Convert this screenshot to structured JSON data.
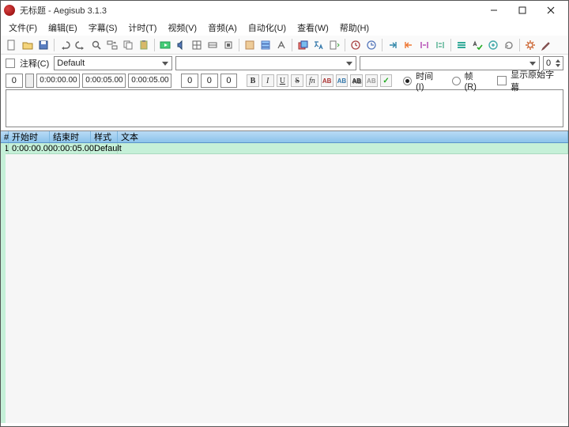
{
  "window": {
    "title": "无标题 - Aegisub 3.1.3"
  },
  "menu": {
    "file": "文件(F)",
    "edit": "编辑(E)",
    "subtitle": "字幕(S)",
    "timing": "计时(T)",
    "video": "视频(V)",
    "audio": "音频(A)",
    "automation": "自动化(U)",
    "view": "查看(W)",
    "help": "帮助(H)"
  },
  "editbar": {
    "comment_label": "注释(C)",
    "style_value": "Default",
    "actor_value": "",
    "effect_value": "",
    "layer": "0",
    "start": "0:00:00.00",
    "end": "0:00:05.00",
    "duration": "0:00:05.00",
    "margin_l": "0",
    "margin_r": "0",
    "margin_v": "0",
    "char_count": "0",
    "time_label": "时间(I)",
    "frame_label": "帧(R)",
    "show_original_label": "显示原始字幕",
    "ab": "AB"
  },
  "grid": {
    "headers": {
      "num": "#",
      "start": "开始时间",
      "end": "结束时间",
      "style": "样式",
      "text": "文本"
    },
    "rows": [
      {
        "num": "1",
        "start": "0:00:00.00",
        "end": "0:00:05.00",
        "style": "Default",
        "text": ""
      }
    ]
  }
}
